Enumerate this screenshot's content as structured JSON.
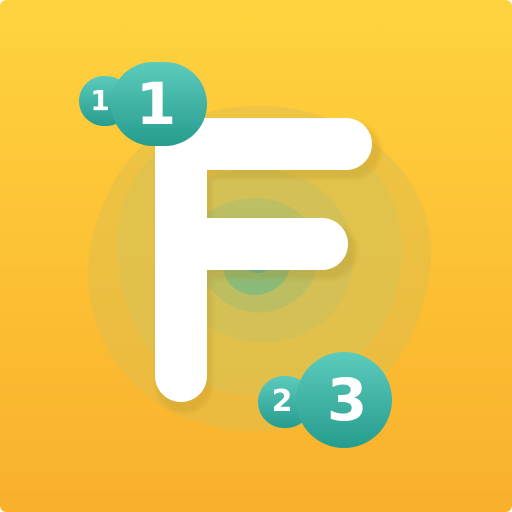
{
  "colors": {
    "background_top": "#FFD23F",
    "background_bottom": "#F9B12C",
    "letter": "#FFFFFF",
    "chip_light": "#4DC3B3",
    "chip_dark": "#2A9E92",
    "blob_outer": "#D8C45A",
    "blob_center": "#3FB2AE"
  },
  "letter": "F",
  "badges": {
    "top_small": "1",
    "top_large": "1",
    "bottom_small": "2",
    "bottom_large": "3"
  }
}
